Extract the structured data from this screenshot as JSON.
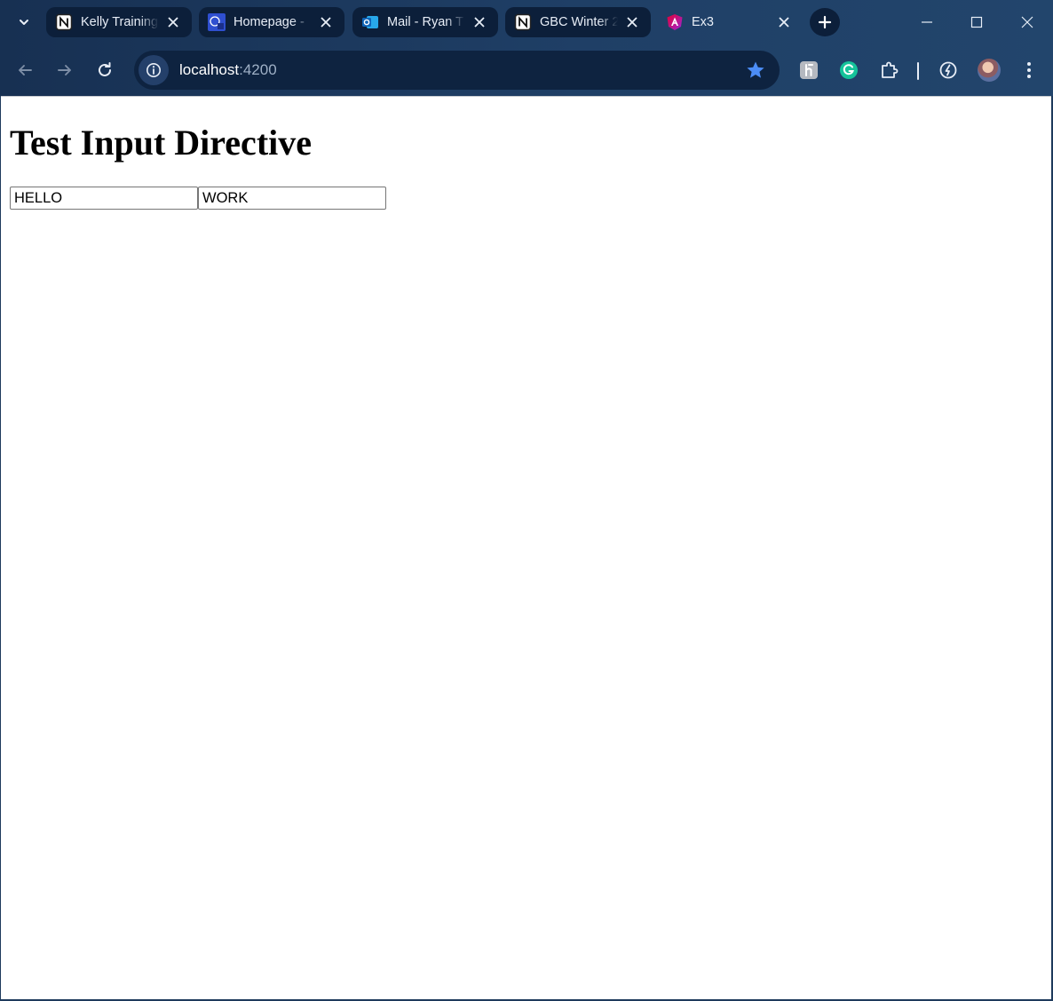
{
  "browser": {
    "tabs": [
      {
        "title": "Kelly Training",
        "favicon": "notion-icon",
        "active": false
      },
      {
        "title": "Homepage - ",
        "favicon": "college-logo-icon",
        "active": false
      },
      {
        "title": "Mail - Ryan T",
        "favicon": "outlook-icon",
        "active": false
      },
      {
        "title": "GBC Winter 2",
        "favicon": "notion-icon",
        "active": false
      },
      {
        "title": "Ex3",
        "favicon": "angular-icon",
        "active": true
      }
    ],
    "address_host": "localhost",
    "address_port": ":4200",
    "accent_color": "#4c8df6"
  },
  "page": {
    "heading": "Test Input Directive",
    "inputs": [
      {
        "value": "HELLO"
      },
      {
        "value": "WORK"
      }
    ]
  }
}
